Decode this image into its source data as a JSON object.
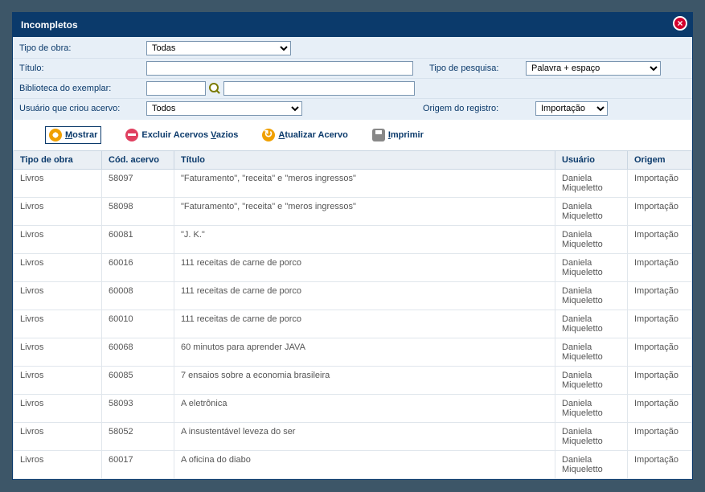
{
  "header": {
    "title": "Incompletos"
  },
  "filters": {
    "tipo_obra_label": "Tipo de obra:",
    "tipo_obra_value": "Todas",
    "titulo_label": "Título:",
    "titulo_value": "",
    "tipo_pesquisa_label": "Tipo de pesquisa:",
    "tipo_pesquisa_value": "Palavra + espaço",
    "biblioteca_label": "Biblioteca do exemplar:",
    "biblioteca_code": "",
    "biblioteca_name": "",
    "usuario_label": "Usuário que criou acervo:",
    "usuario_value": "Todos",
    "origem_label": "Origem do registro:",
    "origem_value": "Importação"
  },
  "actions": {
    "mostrar": "Mostrar",
    "excluir": "Excluir Acervos Vazios",
    "atualizar": "Atualizar Acervo",
    "imprimir": "Imprimir"
  },
  "table": {
    "headers": {
      "tipo": "Tipo de obra",
      "cod": "Cód. acervo",
      "titulo": "Título",
      "usuario": "Usuário",
      "origem": "Origem"
    },
    "rows": [
      {
        "tipo": "Livros",
        "cod": "58097",
        "titulo": "\"Faturamento\", \"receita\" e \"meros ingressos\"",
        "usuario": "Daniela Miqueletto",
        "origem": "Importação"
      },
      {
        "tipo": "Livros",
        "cod": "58098",
        "titulo": "\"Faturamento\", \"receita\" e \"meros ingressos\"",
        "usuario": "Daniela Miqueletto",
        "origem": "Importação"
      },
      {
        "tipo": "Livros",
        "cod": "60081",
        "titulo": "\"J. K.\"",
        "usuario": "Daniela Miqueletto",
        "origem": "Importação"
      },
      {
        "tipo": "Livros",
        "cod": "60016",
        "titulo": "111 receitas de carne de porco",
        "usuario": "Daniela Miqueletto",
        "origem": "Importação"
      },
      {
        "tipo": "Livros",
        "cod": "60008",
        "titulo": "111 receitas de carne de porco",
        "usuario": "Daniela Miqueletto",
        "origem": "Importação"
      },
      {
        "tipo": "Livros",
        "cod": "60010",
        "titulo": "111 receitas de carne de porco",
        "usuario": "Daniela Miqueletto",
        "origem": "Importação"
      },
      {
        "tipo": "Livros",
        "cod": "60068",
        "titulo": "60 minutos para aprender JAVA",
        "usuario": "Daniela Miqueletto",
        "origem": "Importação"
      },
      {
        "tipo": "Livros",
        "cod": "60085",
        "titulo": "7 ensaios sobre a economia brasileira",
        "usuario": "Daniela Miqueletto",
        "origem": "Importação"
      },
      {
        "tipo": "Livros",
        "cod": "58093",
        "titulo": "A eletrônica",
        "usuario": "Daniela Miqueletto",
        "origem": "Importação"
      },
      {
        "tipo": "Livros",
        "cod": "58052",
        "titulo": "A insustentável leveza do ser",
        "usuario": "Daniela Miqueletto",
        "origem": "Importação"
      },
      {
        "tipo": "Livros",
        "cod": "60017",
        "titulo": "A oficina do diabo",
        "usuario": "Daniela Miqueletto",
        "origem": "Importação"
      }
    ]
  }
}
